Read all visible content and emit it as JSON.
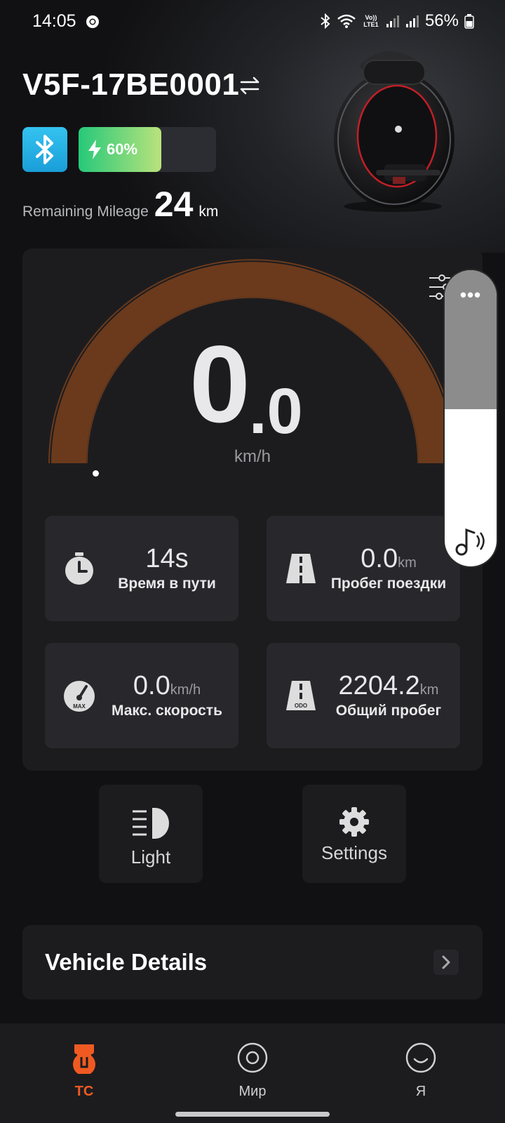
{
  "status_bar": {
    "time": "14:05",
    "volte": "Vo)) LTE1",
    "battery_percent": "56%"
  },
  "device": {
    "title": "V5F-17BE0001",
    "battery_text": "60%",
    "battery_level": 0.6,
    "mileage_label": "Remaining Mileage",
    "mileage_value": "24",
    "mileage_unit": "km"
  },
  "speedometer": {
    "speed_int": "0",
    "speed_dec": ".0",
    "unit": "km/h"
  },
  "stats": [
    {
      "value": "14s",
      "unit": "",
      "label": "Время в пути",
      "icon": "stopwatch-icon"
    },
    {
      "value": "0.0",
      "unit": "km",
      "label": "Пробег поездки",
      "icon": "road-icon"
    },
    {
      "value": "0.0",
      "unit": "km/h",
      "label": "Макс. скорость",
      "icon": "max-speed-gauge-icon",
      "icon_text": "MAX"
    },
    {
      "value": "2204.2",
      "unit": "km",
      "label": "Общий пробег",
      "icon": "odometer-road-icon",
      "icon_text": "ODO"
    }
  ],
  "floating_panel": {
    "dots": "•••",
    "level": 0.53
  },
  "quick_actions": {
    "light_label": "Light",
    "settings_label": "Settings"
  },
  "details": {
    "title": "Vehicle Details"
  },
  "bottom_nav": [
    {
      "label": "TC",
      "icon": "vehicle-icon",
      "active": true
    },
    {
      "label": "Мир",
      "icon": "world-circle-icon",
      "active": false
    },
    {
      "label": "Я",
      "icon": "profile-smile-icon",
      "active": false
    }
  ],
  "colors": {
    "accent": "#f05a22",
    "gauge_arc": "#6b3a1c",
    "battery_green": "#26c97a",
    "bluetooth_blue": "#1a9ed9"
  }
}
